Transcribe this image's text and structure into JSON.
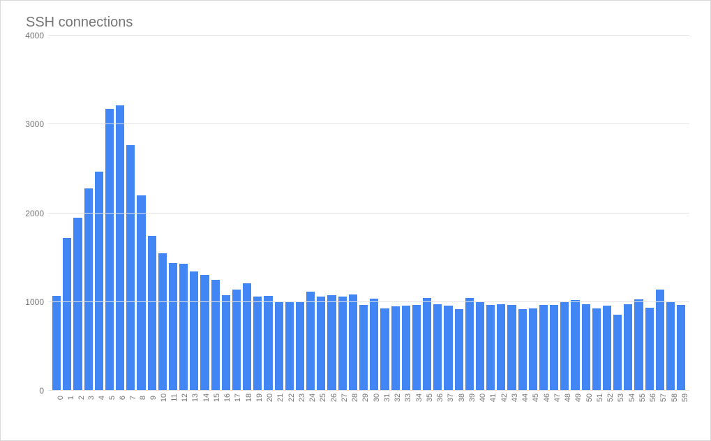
{
  "chart_data": {
    "type": "bar",
    "title": "SSH connections",
    "xlabel": "",
    "ylabel": "",
    "ylim": [
      0,
      4000
    ],
    "yticks": [
      0,
      1000,
      2000,
      3000,
      4000
    ],
    "categories": [
      "0",
      "1",
      "2",
      "3",
      "4",
      "5",
      "6",
      "7",
      "8",
      "9",
      "10",
      "11",
      "12",
      "13",
      "14",
      "15",
      "16",
      "17",
      "18",
      "19",
      "20",
      "21",
      "22",
      "23",
      "24",
      "25",
      "26",
      "27",
      "28",
      "29",
      "30",
      "31",
      "32",
      "33",
      "34",
      "35",
      "36",
      "37",
      "38",
      "39",
      "40",
      "41",
      "42",
      "43",
      "44",
      "45",
      "46",
      "47",
      "48",
      "49",
      "50",
      "51",
      "52",
      "53",
      "54",
      "55",
      "56",
      "57",
      "58",
      "59"
    ],
    "values": [
      1060,
      1710,
      1940,
      2270,
      2460,
      3170,
      3210,
      2760,
      2190,
      1740,
      1540,
      1430,
      1420,
      1340,
      1300,
      1240,
      1070,
      1130,
      1200,
      1050,
      1060,
      1000,
      990,
      1000,
      1110,
      1050,
      1070,
      1050,
      1080,
      960,
      1030,
      920,
      940,
      950,
      960,
      1040,
      970,
      950,
      910,
      1040,
      1000,
      960,
      970,
      960,
      910,
      920,
      960,
      960,
      990,
      1010,
      970,
      920,
      950,
      850,
      970,
      1020,
      930,
      1130,
      990,
      960
    ],
    "bar_color": "#4285f4",
    "grid_color": "#e2e2e2"
  }
}
